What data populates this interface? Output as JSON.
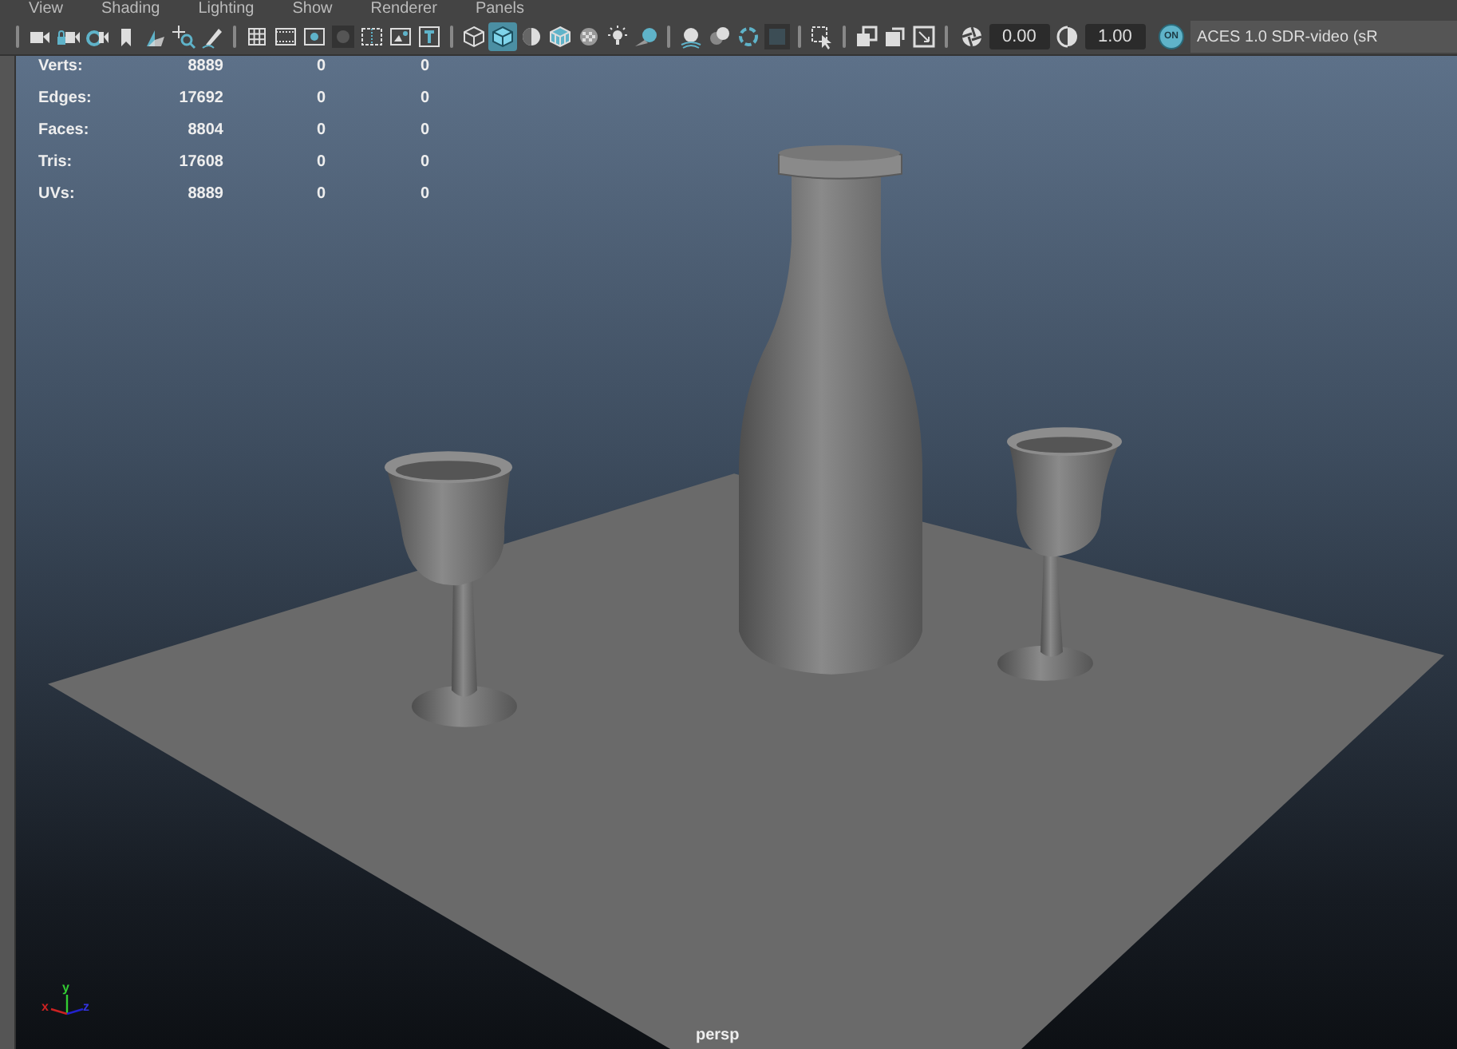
{
  "menu": [
    {
      "label": "View"
    },
    {
      "label": "Shading"
    },
    {
      "label": "Lighting"
    },
    {
      "label": "Show"
    },
    {
      "label": "Renderer"
    },
    {
      "label": "Panels"
    }
  ],
  "toolbar": [
    {
      "kind": "separator"
    },
    {
      "kind": "camera",
      "selected": false
    },
    {
      "kind": "camera-lock",
      "selected": false
    },
    {
      "kind": "camera-gear",
      "selected": false
    },
    {
      "kind": "bookmark",
      "selected": false
    },
    {
      "kind": "image-plane",
      "selected": false
    },
    {
      "kind": "pan-zoom",
      "selected": false
    },
    {
      "kind": "pencil",
      "selected": false
    },
    {
      "kind": "separator"
    },
    {
      "kind": "grid",
      "selected": false
    },
    {
      "kind": "film-gate",
      "selected": false
    },
    {
      "kind": "resolution-gate",
      "selected": false
    },
    {
      "kind": "gate-mask",
      "selected": false
    },
    {
      "kind": "field-chart",
      "selected": false
    },
    {
      "kind": "safe-action",
      "selected": false
    },
    {
      "kind": "safe-title",
      "selected": false
    },
    {
      "kind": "separator"
    },
    {
      "kind": "wireframe",
      "selected": false
    },
    {
      "kind": "shaded",
      "selected": true
    },
    {
      "kind": "material",
      "selected": false
    },
    {
      "kind": "wire-on-shaded",
      "selected": false
    },
    {
      "kind": "xray",
      "selected": false
    },
    {
      "kind": "lights",
      "selected": false
    },
    {
      "kind": "shadows",
      "selected": false
    },
    {
      "kind": "separator"
    },
    {
      "kind": "ao",
      "selected": false
    },
    {
      "kind": "motion-blur",
      "selected": false
    },
    {
      "kind": "anti-alias",
      "selected": false
    },
    {
      "kind": "dof",
      "selected": false
    },
    {
      "kind": "separator"
    },
    {
      "kind": "isolate",
      "selected": false
    },
    {
      "kind": "separator"
    },
    {
      "kind": "xray-joints",
      "selected": false
    },
    {
      "kind": "xray-active",
      "selected": false
    },
    {
      "kind": "backface",
      "selected": false
    },
    {
      "kind": "separator"
    }
  ],
  "exposure": {
    "value": "0.00"
  },
  "gamma": {
    "value": "1.00"
  },
  "view_transform": {
    "label": "ON",
    "on": true
  },
  "color_space": {
    "value": "ACES 1.0 SDR-video (sR"
  },
  "viewport": {
    "hud": [
      {
        "label": "Verts:",
        "values": [
          "8889",
          "0",
          "0"
        ]
      },
      {
        "label": "Edges:",
        "values": [
          "17692",
          "0",
          "0"
        ]
      },
      {
        "label": "Faces:",
        "values": [
          "8804",
          "0",
          "0"
        ]
      },
      {
        "label": "Tris:",
        "values": [
          "17608",
          "0",
          "0"
        ]
      },
      {
        "label": "UVs:",
        "values": [
          "8889",
          "0",
          "0"
        ]
      }
    ],
    "axis": {
      "x": "x",
      "y": "y",
      "z": "z"
    },
    "camera": "persp"
  }
}
